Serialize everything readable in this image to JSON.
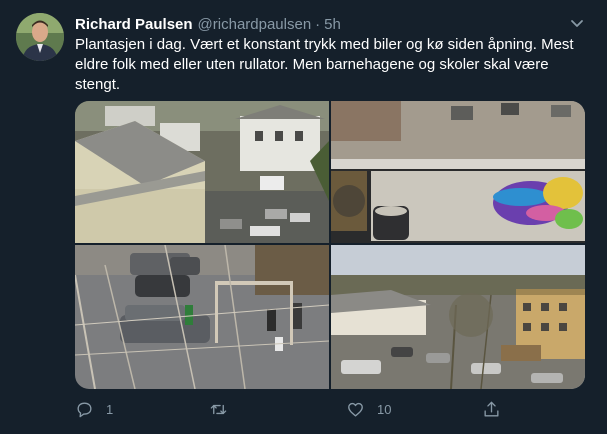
{
  "tweet": {
    "author_name": "Richard Paulsen",
    "author_handle": "@richardpaulsen",
    "separator": "·",
    "time": "5h",
    "text": "Plantasjen i dag. Vært et konstant trykk med biler og kø siden åpning. Mest eldre folk med eller uten rullator. Men barnehagene og skoler skal være stengt.",
    "reply_count": "1",
    "retweet_count": "",
    "like_count": "10"
  },
  "icons": {
    "caret": "chevron-down-icon",
    "reply": "reply-icon",
    "retweet": "retweet-icon",
    "like": "heart-icon",
    "share": "share-icon"
  },
  "colors": {
    "background": "#15202b",
    "secondary_text": "#8899a6",
    "primary_text": "#ffffff"
  }
}
